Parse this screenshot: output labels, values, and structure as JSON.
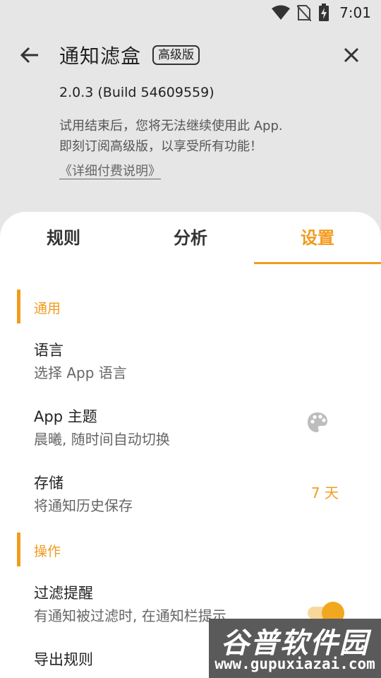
{
  "status_bar": {
    "time": "7:01",
    "icons": [
      "wifi-icon",
      "no-sim-icon",
      "battery-charging-icon"
    ]
  },
  "header": {
    "back_icon": "arrow-back-icon",
    "title": "通知滤盒",
    "badge": "高级版",
    "close_icon": "close-icon"
  },
  "info": {
    "version": "2.0.3  (Build 54609559)",
    "notice_line1": "试用结束后，您将无法继续使用此 App.",
    "notice_line2": "即刻订阅高级版，以享受所有功能！",
    "pricing_link": "《详细付费说明》"
  },
  "tabs": [
    {
      "label": "规则",
      "active": false
    },
    {
      "label": "分析",
      "active": false
    },
    {
      "label": "设置",
      "active": true
    }
  ],
  "sections": {
    "general": {
      "label": "通用",
      "items": [
        {
          "title": "语言",
          "summary": "选择 App 语言"
        },
        {
          "title": "App 主题",
          "summary": "晨曦, 随时间自动切换",
          "icon": "palette-icon"
        },
        {
          "title": "存储",
          "summary": "将通知历史保存",
          "value": "7 天"
        }
      ]
    },
    "actions": {
      "label": "操作",
      "items": [
        {
          "title": "过滤提醒",
          "summary": "有通知被过滤时, 在通知栏提示",
          "toggle_on": true
        },
        {
          "title": "导出规则"
        }
      ]
    }
  },
  "watermark": {
    "title": "谷普软件园",
    "url": "www.gupuxiazai.com"
  },
  "colors": {
    "accent": "#f29b1e",
    "background": "#e6e6e6",
    "sheet": "#ffffff"
  }
}
